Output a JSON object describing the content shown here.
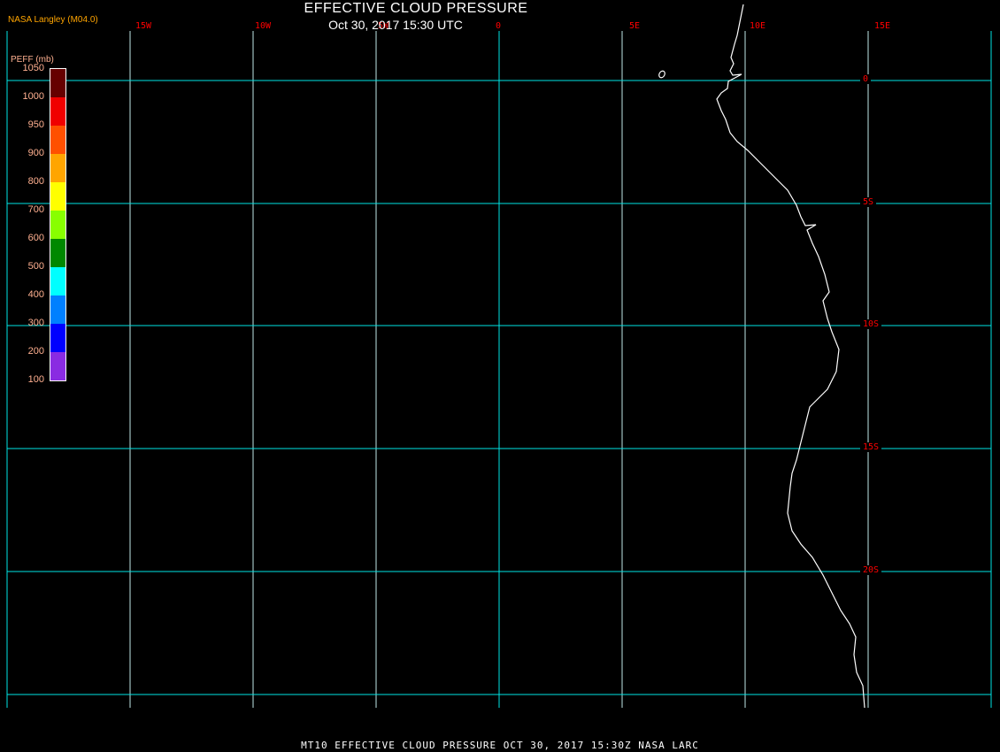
{
  "header": {
    "title": "EFFECTIVE CLOUD PRESSURE",
    "subtitle": "Oct 30, 2017 15:30 UTC",
    "source": "NASA Langley (M04.0)"
  },
  "footer": "MT10  EFFECTIVE CLOUD PRESSURE   OCT 30, 2017 15:30Z   NASA LARC",
  "map": {
    "longitude_labels": [
      "15W",
      "10W",
      "5W",
      "0",
      "5E",
      "10E",
      "15E"
    ],
    "latitude_labels": [
      "0",
      "5S",
      "10S",
      "15S",
      "20S"
    ],
    "grid_color": "#00e5e5",
    "coastline_color": "#ffffff",
    "label_color": "#ff0000"
  },
  "legend": {
    "title": "PEFF (mb)",
    "ticks": [
      "1050",
      "1000",
      "950",
      "900",
      "800",
      "700",
      "600",
      "500",
      "400",
      "300",
      "200",
      "100"
    ],
    "colors": [
      "#660000",
      "#f00000",
      "#ff5000",
      "#ffa500",
      "#ffff00",
      "#88ff00",
      "#008800",
      "#00ffff",
      "#0080ff",
      "#0000ff",
      "#8a2be2"
    ]
  }
}
